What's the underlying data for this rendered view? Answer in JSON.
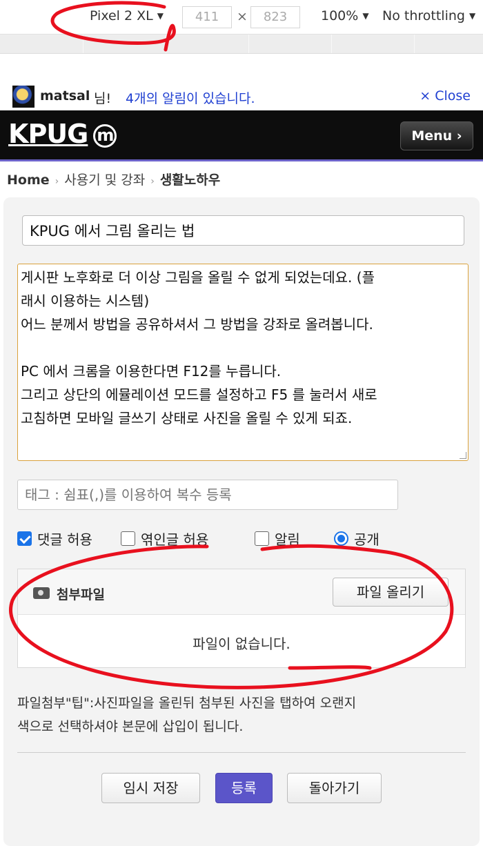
{
  "devtools": {
    "device": "Pixel 2 XL",
    "width": "411",
    "times": "×",
    "height": "823",
    "zoom": "100%",
    "throttling": "No throttling",
    "dropdown_glyph": "▼"
  },
  "notice": {
    "user": "matsal",
    "suffix": "님!",
    "message": "4개의 알림이 있습니다.",
    "close": "× Close"
  },
  "header": {
    "logo": "KPUG",
    "logo_mark": "m",
    "menu": "Menu ›"
  },
  "breadcrumb": {
    "home": "Home",
    "sep": "›",
    "level1": "사용기 및 강좌",
    "level2": "생활노하우"
  },
  "form": {
    "title_value": "KPUG 에서 그림 올리는 법",
    "body_lines": [
      "게시판 노후화로 더 이상 그림을 올릴 수 없게 되었는데요. (플",
      "래시 이용하는 시스템)",
      "어느 분께서 방법을 공유하셔서 그 방법을 강좌로 올려봅니다.",
      "",
      "PC 에서 크롬을 이용한다면 F12를 누릅니다.",
      "그리고 상단의 에뮬레이션 모드를 설정하고 F5 를 눌러서 새로",
      "고침하면 모바일 글쓰기 상태로 사진을 올릴 수 있게 되죠."
    ],
    "tags_placeholder": "태그 : 쉼표(,)를 이용하여 복수 등록",
    "options": {
      "comments": "댓글 허용",
      "linked": "엮인글 허용",
      "notify": "알림",
      "public": "공개"
    },
    "attach": {
      "title": "첨부파일",
      "upload": "파일 올리기",
      "empty": "파일이 없습니다."
    },
    "tip_line1": "파일첨부\"팁\":사진파일을 올린뒤 첨부된 사진을 탭하여 오랜지",
    "tip_line2": "색으로 선택하셔야 본문에 삽입이 됩니다.",
    "buttons": {
      "save": "임시 저장",
      "submit": "등록",
      "back": "돌아가기"
    }
  },
  "colors": {
    "accent": "#5b55c9",
    "link": "#1f3fd1",
    "annotation": "#e8101e",
    "textarea_border": "#d9a13b"
  }
}
